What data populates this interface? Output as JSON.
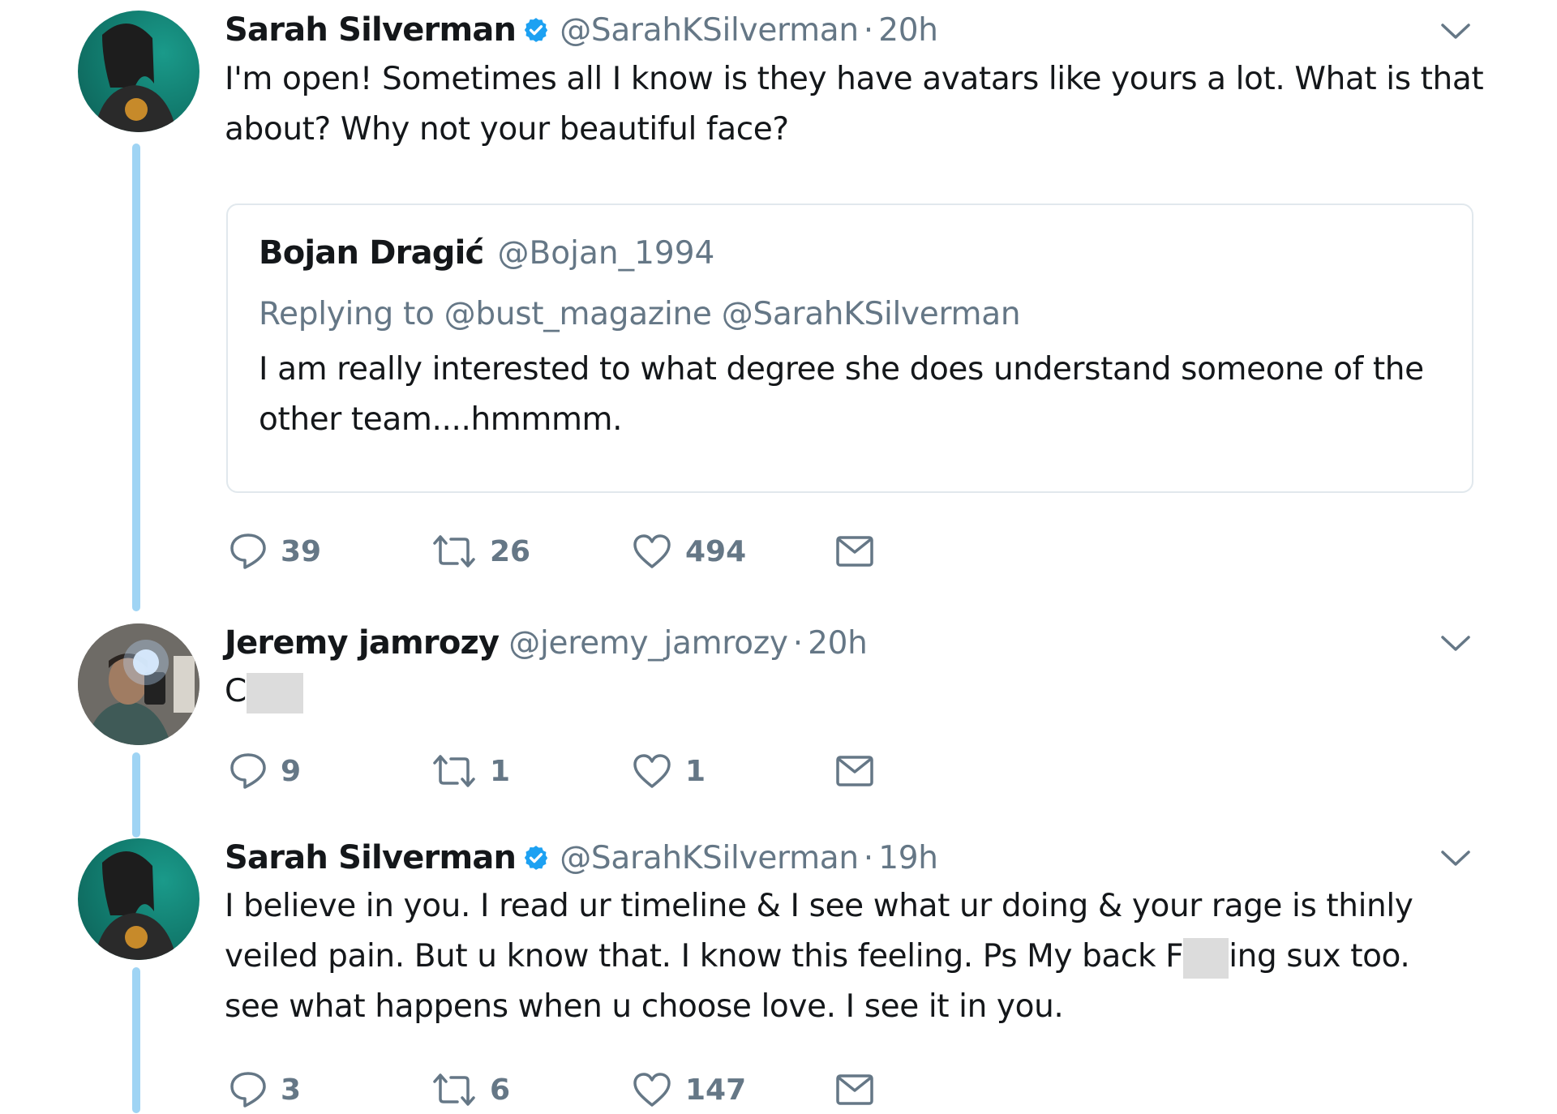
{
  "tweets": [
    {
      "name": "Sarah Silverman",
      "verified": true,
      "handle": "@SarahKSilverman",
      "separator": "·",
      "time": "20h",
      "text_lines": [
        "I'm open! Sometimes all I know is they have avatars like yours a lot. What is that",
        "about? Why not your beautiful face?"
      ],
      "quote": {
        "name": "Bojan Dragić",
        "handle": "@Bojan_1994",
        "replying": "Replying to @bust_magazine @SarahKSilverman",
        "text_lines": [
          "I am really interested to what degree she does understand someone of the",
          "other team....hmmmm."
        ]
      },
      "replies": "39",
      "retweets": "26",
      "likes": "494"
    },
    {
      "name": "Jeremy jamrozy",
      "verified": false,
      "handle": "@jeremy_jamrozy",
      "separator": "·",
      "time": "20h",
      "text_lines": [
        "C"
      ],
      "replies": "9",
      "retweets": "1",
      "likes": "1"
    },
    {
      "name": "Sarah Silverman",
      "verified": true,
      "handle": "@SarahKSilverman",
      "separator": "·",
      "time": "19h",
      "text_lines": [
        "I believe in you. I read ur timeline & I see what ur doing & your rage is thinly",
        "veiled pain. But u know that.  I know this feeling. Ps My back F",
        "ing sux too.",
        "see what happens when u choose love. I see it in you."
      ],
      "replies": "3",
      "retweets": "6",
      "likes": "147"
    }
  ],
  "colors": {
    "text": "#14171a",
    "secondary": "#657786",
    "thread_line": "#9fd4f4",
    "verified": "#1da1f2",
    "quote_border": "#e1e8ed"
  },
  "icons": [
    "reply-icon",
    "retweet-icon",
    "like-icon",
    "dm-icon",
    "chevron-down-icon",
    "verified-icon"
  ]
}
